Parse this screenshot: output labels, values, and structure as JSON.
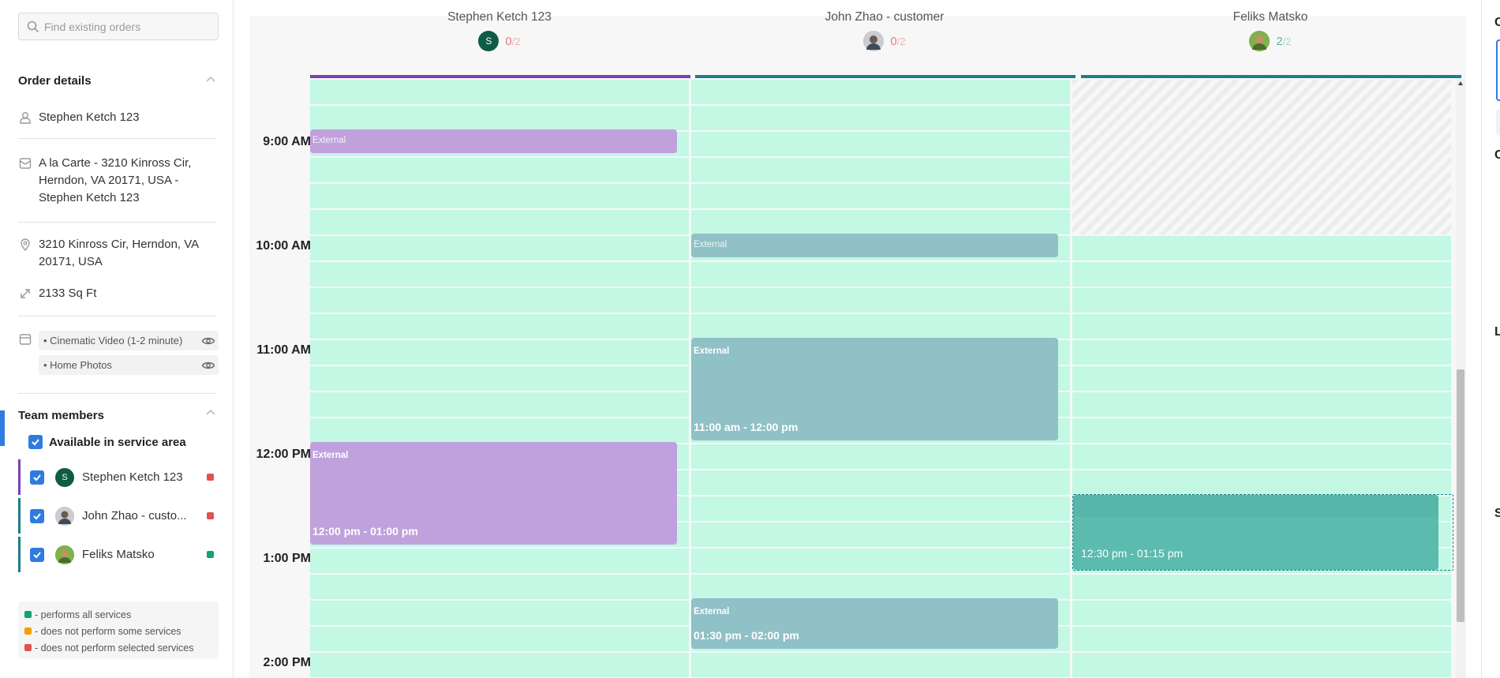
{
  "search": {
    "placeholder": "Find existing orders"
  },
  "order_details": {
    "title": "Order details",
    "customer": "Stephen Ketch 123",
    "order": "A la Carte - 3210 Kinross Cir, Herndon, VA 20171, USA - Stephen Ketch 123",
    "address": "3210 Kinross Cir, Herndon, VA 20171, USA",
    "size": "2133 Sq Ft",
    "services": [
      "• Cinematic Video (1-2 minute)",
      "• Home Photos"
    ]
  },
  "team": {
    "title": "Team members",
    "available_label": "Available in service area",
    "members": [
      {
        "name": "Stephen Ketch 123",
        "initial": "S",
        "color": "#7b3fb0",
        "status_color": "#e05252"
      },
      {
        "name": "John Zhao - custo...",
        "color": "#1c7f85",
        "status_color": "#e05252"
      },
      {
        "name": "Feliks Matsko",
        "color": "#1c7f85",
        "status_color": "#10a36e"
      }
    ]
  },
  "legend": [
    {
      "text": "- performs all services",
      "color": "#10a36e"
    },
    {
      "text": "- does not perform some services",
      "color": "#f2a100"
    },
    {
      "text": "- does not perform selected services",
      "color": "#e05252"
    }
  ],
  "calendar": {
    "columns": [
      {
        "name": "Stephen Ketch 123",
        "count": "0",
        "total": "/2",
        "count_color": "#e87b7b",
        "bar_color": "#7b3fb0"
      },
      {
        "name": "John Zhao - customer",
        "count": "0",
        "total": "/2",
        "count_color": "#e87b7b",
        "bar_color": "#1c7f85"
      },
      {
        "name": "Feliks Matsko",
        "count": "2",
        "total": "/2",
        "count_color": "#4cbf8c",
        "bar_color": "#1c7f85"
      }
    ],
    "time_labels": [
      "9:00 AM",
      "10:00 AM",
      "11:00 AM",
      "12:00 PM",
      "1:00 PM",
      "2:00 PM"
    ],
    "events": {
      "e1": {
        "title": "External"
      },
      "e2": {
        "title": "External"
      },
      "e3": {
        "title": "External",
        "time": "11:00 am - 12:00 pm"
      },
      "e4": {
        "title": "External",
        "time": "12:00 pm - 01:00 pm"
      },
      "e5": {
        "title": "External",
        "time": "01:30 pm - 02:00 pm"
      },
      "e6": {
        "time": "12:30 pm - 01:15 pm"
      }
    }
  },
  "right_panel": {
    "letters": [
      "C",
      "C",
      "L",
      "S"
    ]
  }
}
